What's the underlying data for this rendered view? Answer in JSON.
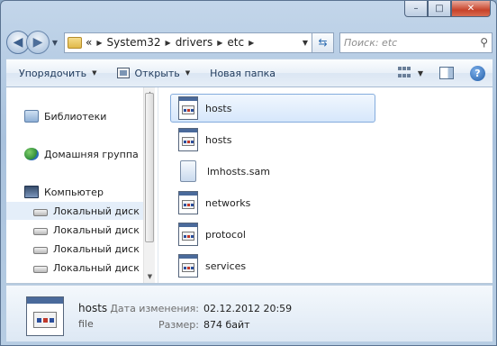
{
  "window": {
    "caption": {
      "minimize": "–",
      "maximize": "□",
      "close": "✕"
    }
  },
  "navigation": {
    "back_icon": "back-arrow-icon",
    "forward_icon": "forward-arrow-icon",
    "overflow": "«",
    "breadcrumb": [
      "System32",
      "drivers",
      "etc"
    ],
    "search_placeholder": "Поиск: etc"
  },
  "commands": {
    "organize": "Упорядочить",
    "open": "Открыть",
    "new_folder": "Новая папка"
  },
  "nav_pane": {
    "items": [
      {
        "label": "Библиотеки",
        "icon": "libraries-icon"
      },
      {
        "label": "Домашняя группа",
        "icon": "homegroup-icon"
      },
      {
        "label": "Компьютер",
        "icon": "computer-icon"
      },
      {
        "label": "Локальный диск",
        "icon": "local-disk-icon",
        "selected": true
      },
      {
        "label": "Локальный диск",
        "icon": "local-disk-icon"
      },
      {
        "label": "Локальный диск",
        "icon": "local-disk-icon"
      },
      {
        "label": "Локальный диск",
        "icon": "local-disk-icon"
      }
    ]
  },
  "files": [
    {
      "name": "hosts",
      "selected": true
    },
    {
      "name": "hosts"
    },
    {
      "name": "lmhosts.sam"
    },
    {
      "name": "networks"
    },
    {
      "name": "protocol"
    },
    {
      "name": "services"
    }
  ],
  "details": {
    "name": "hosts",
    "type": "file",
    "modified_label": "Дата изменения:",
    "modified_value": "02.12.2012 20:59",
    "size_label": "Размер:",
    "size_value": "874 байт"
  }
}
